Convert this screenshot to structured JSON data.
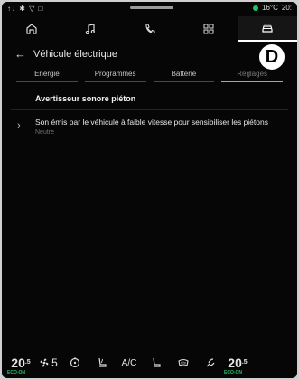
{
  "status_bar": {
    "signal_icons": "↑↓ ✱ ▽ □",
    "temperature": "16°C",
    "time": "20:"
  },
  "top_tabs": [
    {
      "name": "home-icon"
    },
    {
      "name": "music-note-icon"
    },
    {
      "name": "phone-icon"
    },
    {
      "name": "apps-grid-icon"
    },
    {
      "name": "car-icon",
      "active": true
    }
  ],
  "header": {
    "back_glyph": "←",
    "title": "Véhicule électrique"
  },
  "badge_letter": "D",
  "sub_tabs": [
    "Energie",
    "Programmes",
    "Batterie",
    "Réglages"
  ],
  "active_sub_tab": "Réglages",
  "section": {
    "title": "Avertisseur sonore piéton",
    "row_text": "Son émis par le véhicule à faible vitesse pour sensibiliser les piétons",
    "row_value": "Neutre",
    "row_chevron": "›"
  },
  "bottom_bar": {
    "left_temp": "20",
    "left_temp_suffix": ".5",
    "eco_label": "ECO-ON",
    "fan_level": "5",
    "ac_label": "A/C",
    "right_temp": "20",
    "right_temp_suffix": ".5"
  },
  "colors": {
    "background": "#060606",
    "accent_green": "#22c16b",
    "badge": "#ffffff"
  }
}
